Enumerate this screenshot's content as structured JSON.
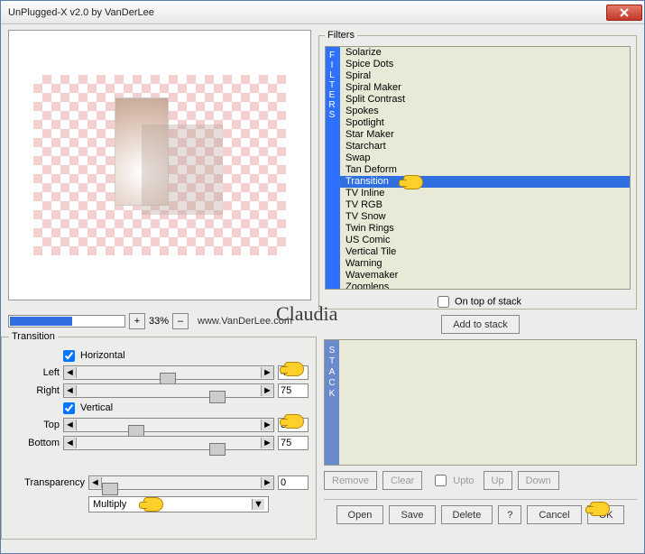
{
  "window": {
    "title": "UnPlugged-X v2.0 by VanDerLee"
  },
  "zoom": {
    "plus": "+",
    "percent": "33%",
    "minus": "–",
    "url": "www.VanDerLee.com"
  },
  "filters": {
    "legend": "Filters",
    "items": [
      "Solarize",
      "Spice Dots",
      "Spiral",
      "Spiral Maker",
      "Split Contrast",
      "Spokes",
      "Spotlight",
      "Star Maker",
      "Starchart",
      "Swap",
      "Tan Deform",
      "Transition",
      "TV Inline",
      "TV RGB",
      "TV Snow",
      "Twin Rings",
      "US Comic",
      "Vertical Tile",
      "Warning",
      "Wavemaker",
      "Zoomlens"
    ],
    "selected": "Transition",
    "ontop_label": "On top of stack"
  },
  "addstack_label": "Add to stack",
  "transition": {
    "legend": "Transition",
    "horizontal_label": "Horizontal",
    "left_label": "Left",
    "left_val": "47",
    "right_label": "Right",
    "right_val": "75",
    "vertical_label": "Vertical",
    "top_label": "Top",
    "top_val": "30",
    "bottom_label": "Bottom",
    "bottom_val": "75",
    "transparency_label": "Transparency",
    "transparency_val": "0",
    "mode": "Multiply"
  },
  "stack": {
    "remove": "Remove",
    "clear": "Clear",
    "upto": "Upto",
    "up": "Up",
    "down": "Down"
  },
  "buttons": {
    "open": "Open",
    "save": "Save",
    "delete": "Delete",
    "help": "?",
    "cancel": "Cancel",
    "ok": "OK"
  },
  "signature": "Claudia"
}
